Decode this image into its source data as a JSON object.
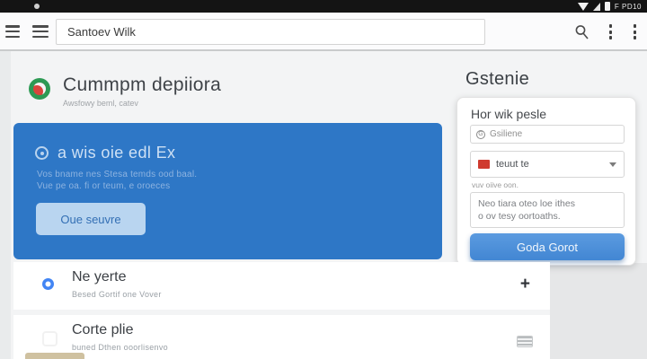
{
  "status_bar": {
    "time": "F PD10"
  },
  "toolbar": {
    "search_value": "Santoev Wilk"
  },
  "app_header": {
    "title": "Cummpm depiiora",
    "subtitle": "Awsfowy beml, catev"
  },
  "banner": {
    "title": "a wis oie edl Ex",
    "line1": "Vos bname nes Stesa temds ood baal.",
    "line2": "Vue pe oa. fi or teum, e oroeces",
    "button_label": "Oue seuvre",
    "bg_color": "#2e77c6",
    "button_color": "#b9d5f0"
  },
  "side_panel": {
    "heading": "Gstenie",
    "card": {
      "title": "Hor wik pesle",
      "input_icon": "G",
      "input_value": "Gsiliene",
      "select_label": "teuut te",
      "select_helper": "vuv oiive oon.",
      "select_color": "#cf3a2e",
      "textarea_line1": "Neo tiara oteo loe ithes",
      "textarea_line2": "o ov tesy oortoaths.",
      "button_label": "Goda Gorot",
      "button_color": "#4286d3"
    }
  },
  "list": {
    "rows": [
      {
        "title": "Ne yerte",
        "subtitle": "Besed Gortif one Vover",
        "action_label": "+"
      },
      {
        "title": "Corte plie",
        "subtitle": "buned Dthen ooorlisenvo"
      }
    ]
  }
}
